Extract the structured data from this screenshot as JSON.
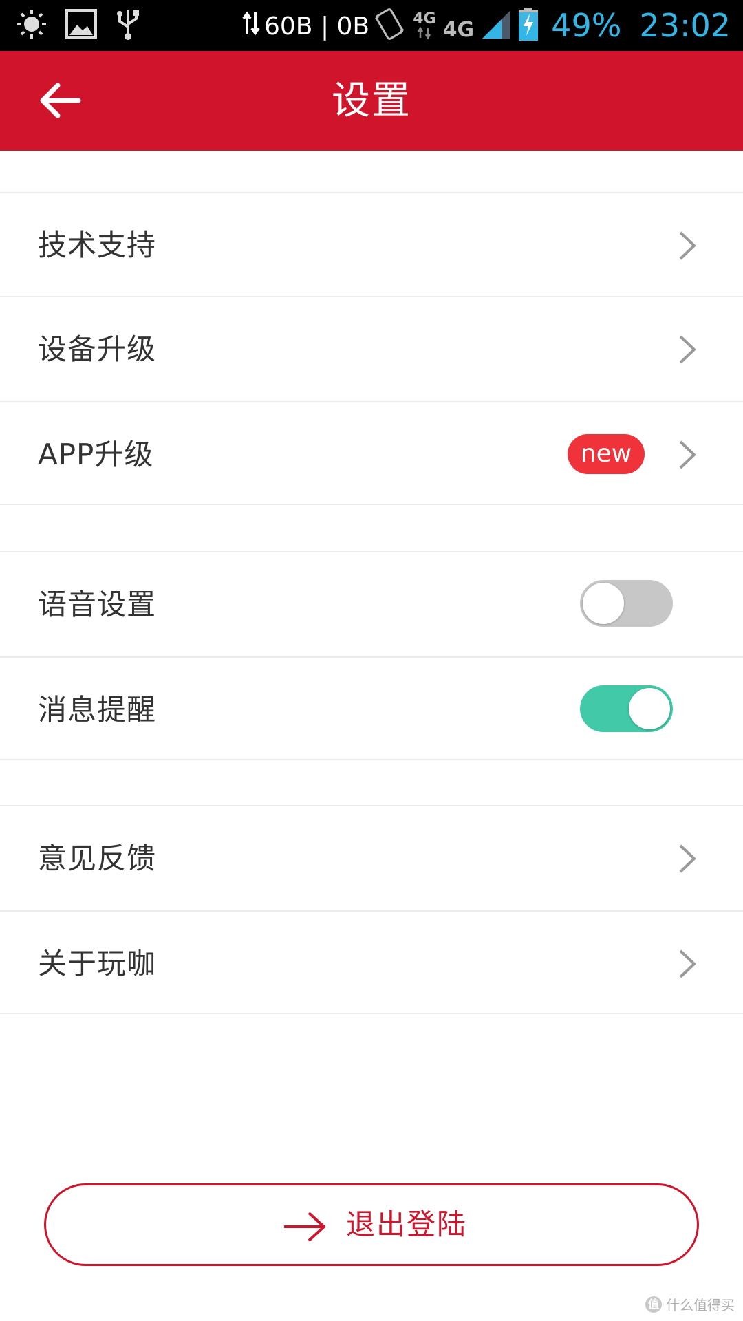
{
  "status_bar": {
    "net_speed": "60B | 0B",
    "network_type_top": "4G",
    "network_type_bottom": "4G",
    "battery_percent": "49%",
    "time": "23:02",
    "time_color": "#33b5e5"
  },
  "app_bar": {
    "title": "设置",
    "color": "#cf142b"
  },
  "sections": {
    "group1": [
      {
        "label": "技术支持"
      },
      {
        "label": "设备升级"
      },
      {
        "label": "APP升级",
        "badge": "new"
      }
    ],
    "group2": [
      {
        "label": "语音设置",
        "toggle": "off"
      },
      {
        "label": "消息提醒",
        "toggle": "on"
      }
    ],
    "group3": [
      {
        "label": "意见反馈"
      },
      {
        "label": "关于玩咖"
      }
    ]
  },
  "logout": {
    "label": "退出登陆"
  },
  "watermark": {
    "logo": "值",
    "text": "什么值得买"
  },
  "colors": {
    "accent": "#cf142b",
    "badge": "#f0323a",
    "toggle_on": "#41c9a8",
    "toggle_off": "#c7c7c7"
  }
}
